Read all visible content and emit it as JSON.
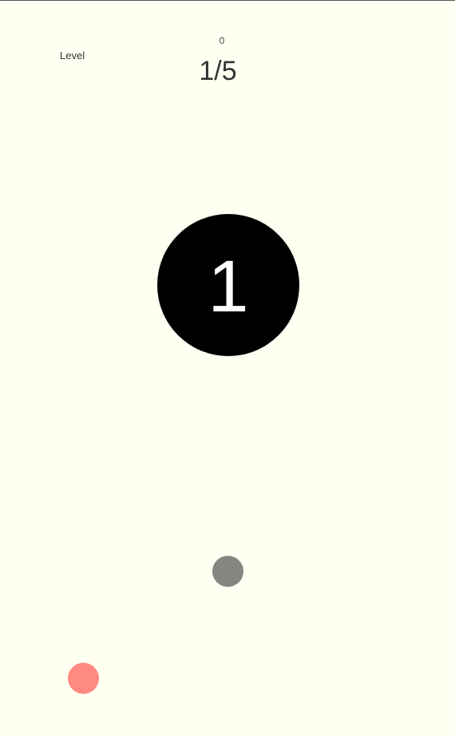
{
  "hud": {
    "score": "0",
    "level_label": "Level",
    "level_progress": "1/5"
  },
  "target": {
    "number": "1",
    "color": "#000000"
  },
  "balls": {
    "gray_color": "#868680",
    "red_color": "#ff8a82"
  },
  "background_color": "#fffff2"
}
